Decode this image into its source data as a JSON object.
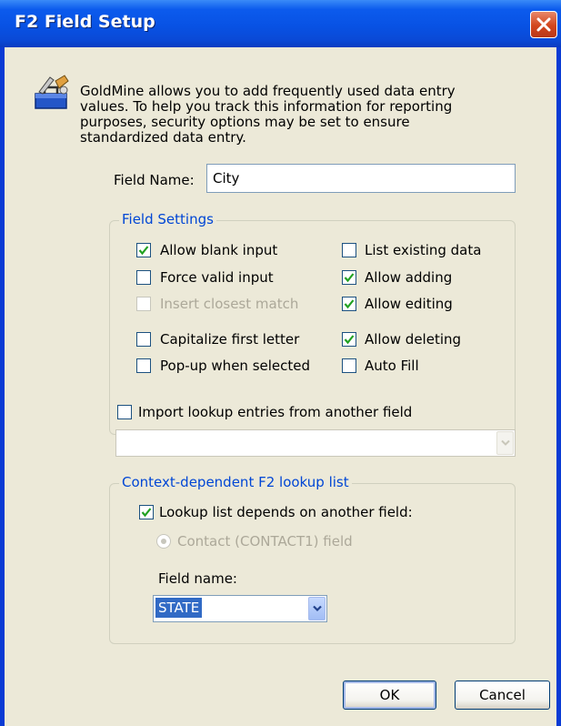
{
  "window": {
    "title": "F2 Field Setup"
  },
  "icons": {
    "app": "toolbox-icon",
    "close": "close-icon",
    "combo_arrow": "chevron-down-icon"
  },
  "description": "GoldMine allows you to add frequently used data entry values. To help you track this information for reporting purposes, security options may be set to ensure standardized data entry.",
  "field_name": {
    "label": "Field Name:",
    "value": "City"
  },
  "field_settings": {
    "legend": "Field Settings",
    "allow_blank": {
      "label": "Allow blank input",
      "checked": true
    },
    "force_valid": {
      "label": "Force valid input",
      "checked": false
    },
    "insert_closest": {
      "label": "Insert closest match",
      "checked": false,
      "disabled": true
    },
    "capitalize": {
      "label": "Capitalize first letter",
      "checked": false
    },
    "popup_selected": {
      "label": "Pop-up when selected",
      "checked": false
    },
    "list_existing": {
      "label": "List existing data",
      "checked": false
    },
    "allow_adding": {
      "label": "Allow adding",
      "checked": true
    },
    "allow_editing": {
      "label": "Allow editing",
      "checked": true
    },
    "allow_deleting": {
      "label": "Allow deleting",
      "checked": true
    },
    "auto_fill": {
      "label": "Auto Fill",
      "checked": false
    }
  },
  "import_lookup": {
    "label": "Import lookup entries from another field",
    "checked": false,
    "value": ""
  },
  "context_group": {
    "legend": "Context-dependent F2 lookup list",
    "depends": {
      "label": "Lookup list depends on another field:",
      "checked": true
    },
    "contact_radio": {
      "label": "Contact (CONTACT1) field",
      "selected": true,
      "disabled": true
    },
    "field_name_label": "Field name:",
    "field_name_value": "STATE"
  },
  "buttons": {
    "ok": "OK",
    "cancel": "Cancel"
  },
  "colors": {
    "titlebar": "#0852e4",
    "dialog_bg": "#ece9d8",
    "legend": "#0046d5",
    "selection": "#316ac5",
    "close": "#d2461e"
  }
}
